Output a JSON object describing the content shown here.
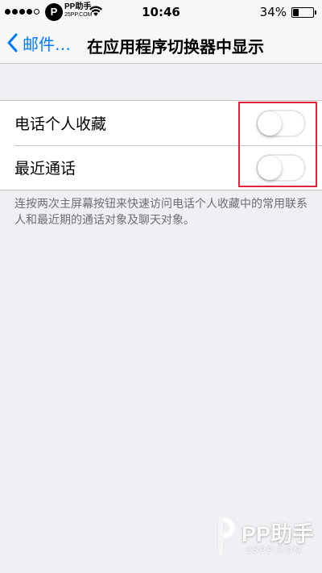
{
  "status_bar": {
    "signal_filled": 4,
    "signal_total": 5,
    "carrier_logo": "P",
    "carrier_name": "PP助手",
    "carrier_sub": "25PP.COM",
    "wifi_icon": "wifi-icon",
    "time": "10:46",
    "battery_percent": "34%",
    "battery_level": 0.34
  },
  "nav": {
    "back_label": "邮件…",
    "title": "在应用程序切换器中显示"
  },
  "settings": {
    "rows": [
      {
        "label": "电话个人收藏",
        "on": false
      },
      {
        "label": "最近通话",
        "on": false
      }
    ],
    "footer": "连按两次主屏幕按钮来快速访问电话个人收藏中的常用联系人和最近期的通话对象及聊天对象。"
  },
  "watermark": {
    "text": "PP助手",
    "sub": "25PP.COM"
  },
  "colors": {
    "accent": "#007aff",
    "highlight": "#e0243a",
    "switch_on": "#4cd964",
    "background": "#efeff4"
  }
}
